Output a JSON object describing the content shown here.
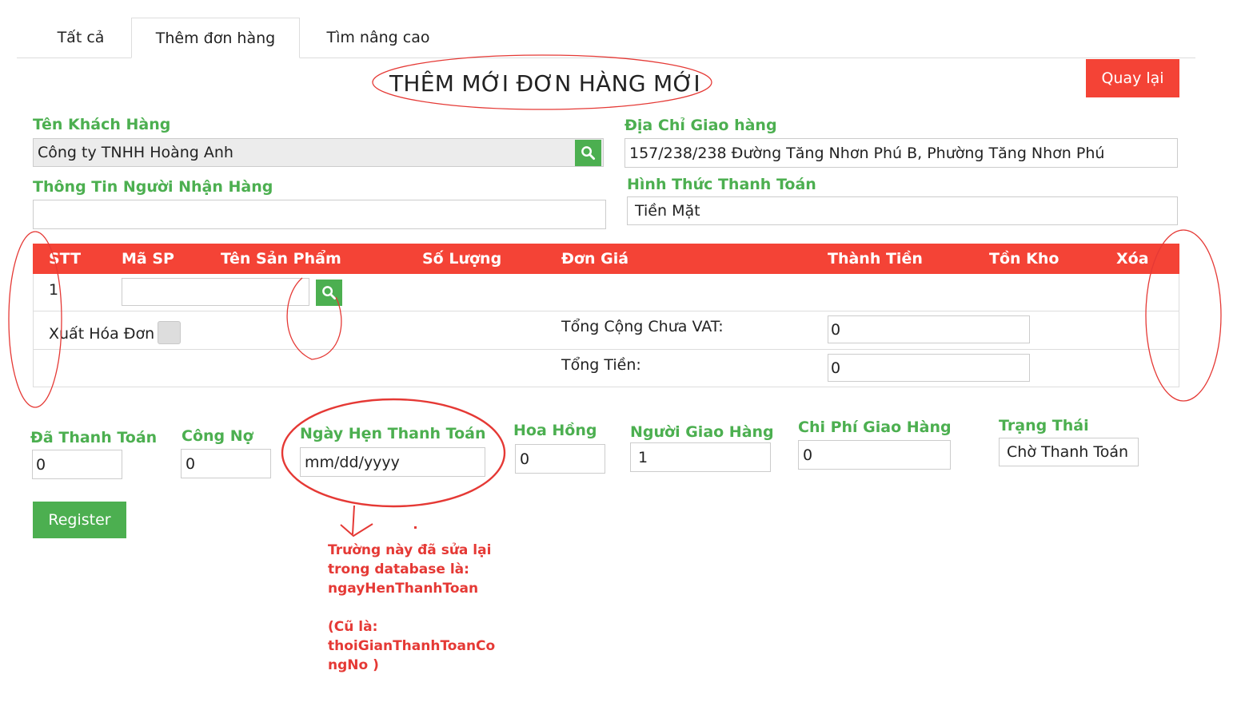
{
  "tabs": [
    {
      "label": "Tất cả"
    },
    {
      "label": "Thêm đơn hàng"
    },
    {
      "label": "Tìm nâng cao"
    }
  ],
  "page_title": "THÊM MỚI ĐƠN HÀNG MỚI",
  "back_button": "Quay lại",
  "customer": {
    "label": "Tên Khách Hàng",
    "value": "Công ty TNHH Hoàng Anh"
  },
  "address": {
    "label": "Địa Chỉ Giao hàng",
    "value": "157/238/238 Đường Tăng Nhơn Phú B, Phường Tăng Nhơn Phú"
  },
  "receiver": {
    "label": "Thông Tin Người Nhận Hàng",
    "value": ""
  },
  "payment_method": {
    "label": "Hình Thức Thanh Toán",
    "value": "Tiền Mặt"
  },
  "table": {
    "headers": [
      "STT",
      "Mã SP",
      "Tên Sản Phẩm",
      "Số Lượng",
      "Đơn Giá",
      "Thành Tiền",
      "Tồn Kho",
      "Xóa"
    ],
    "rows": [
      {
        "stt": "1",
        "code": ""
      }
    ]
  },
  "invoice": {
    "label": "Xuất Hóa Đơn"
  },
  "totals": {
    "subtotal_label": "Tổng Cộng Chưa VAT:",
    "subtotal_value": "0",
    "total_label": "Tổng Tiền:",
    "total_value": "0"
  },
  "bottom_fields": {
    "paid": {
      "label": "Đã Thanh Toán",
      "value": "0"
    },
    "debt": {
      "label": "Công Nợ",
      "value": "0"
    },
    "due_date": {
      "label": "Ngày Hẹn Thanh Toán",
      "value": "mm/dd/yyyy"
    },
    "commission": {
      "label": "Hoa Hồng",
      "value": "0"
    },
    "shipper": {
      "label": "Người Giao Hàng",
      "value": "1"
    },
    "shipping_cost": {
      "label": "Chi Phí Giao Hàng",
      "value": "0"
    },
    "status": {
      "label": "Trạng Thái",
      "value": "Chờ Thanh Toán"
    }
  },
  "register_button": "Register",
  "annotation": {
    "lines": [
      "Trường này đã sửa lại",
      "trong database là:",
      "ngayHenThanhToan",
      "(Cũ là:",
      "thoiGianThanhToanCo",
      "ngNo )"
    ]
  },
  "colors": {
    "accent_green": "#4caf50",
    "accent_red": "#f44336",
    "annotation_red": "#e53935"
  }
}
